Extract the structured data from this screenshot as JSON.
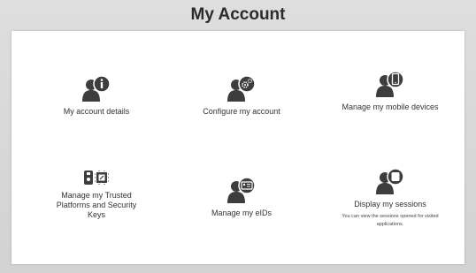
{
  "page": {
    "title": "My Account"
  },
  "tiles": [
    {
      "label": "My account details",
      "icon": "user-info-icon"
    },
    {
      "label": "Configure my account",
      "icon": "user-gear-icon"
    },
    {
      "label": "Manage my mobile devices",
      "icon": "user-mobile-icon"
    },
    {
      "label": "Manage my Trusted Platforms and Security Keys",
      "icon": "security-keys-icon"
    },
    {
      "label": "Manage my eIDs",
      "icon": "user-eid-card-icon"
    },
    {
      "label": "Display my sessions",
      "icon": "user-sessions-icon",
      "description": "You can view the sessions opened for visited applications."
    }
  ],
  "colors": {
    "icon": "#3d3d3d",
    "background": "#d6d6d6",
    "panel": "#ffffff"
  }
}
